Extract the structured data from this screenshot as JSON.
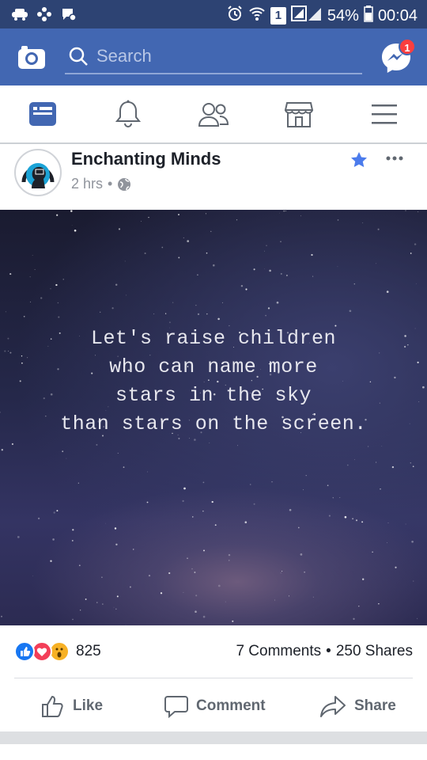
{
  "status_bar": {
    "battery": "54%",
    "time": "00:04",
    "sim": "1"
  },
  "top_bar": {
    "search_placeholder": "Search",
    "messenger_badge": "1"
  },
  "nav": {
    "items": [
      "news-feed",
      "notifications",
      "friends",
      "marketplace",
      "menu"
    ],
    "active": "news-feed"
  },
  "post": {
    "page_name": "Enchanting Minds",
    "time": "2 hrs",
    "separator": "•",
    "quote_lines": [
      "Let's raise children",
      "who can name more",
      "stars in the sky",
      "than stars on the screen."
    ],
    "reaction_count": "825",
    "comments": "7 Comments",
    "stats_sep": "•",
    "shares": "250 Shares",
    "actions": {
      "like": "Like",
      "comment": "Comment",
      "share": "Share"
    }
  },
  "colors": {
    "brand": "#4267b2",
    "status_bar": "#2d4373",
    "like_blue": "#1877f2",
    "love_red": "#f33e58",
    "wow_yellow": "#f7b125"
  }
}
